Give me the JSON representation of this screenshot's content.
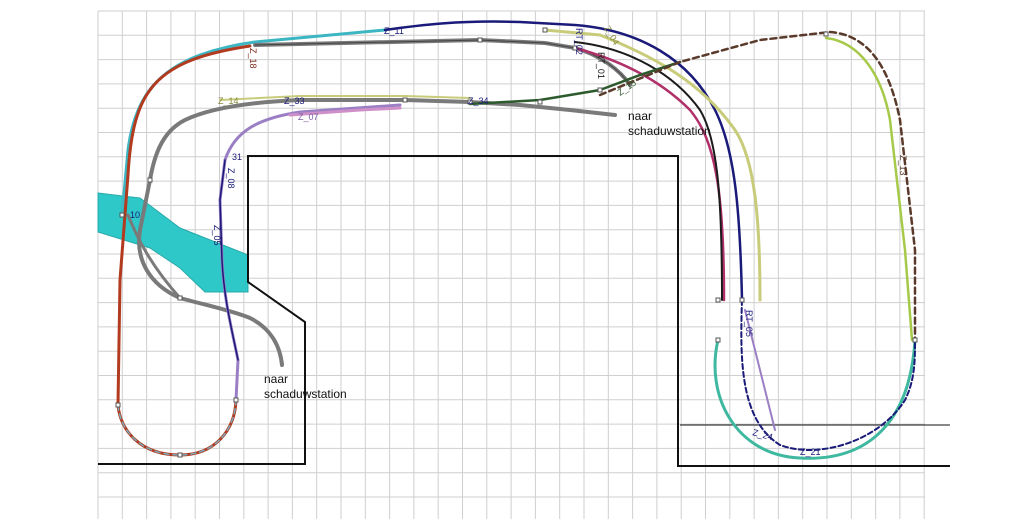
{
  "diagram": {
    "notes": [
      {
        "key": "shadow_right",
        "line1": "naar",
        "line2": "schaduwstation"
      },
      {
        "key": "shadow_left",
        "line1": "naar",
        "line2": "schaduwstation"
      }
    ],
    "labels": {
      "z11": "Z_11",
      "z18": "Z_18",
      "z14": "Z_14",
      "z33": "Z_33",
      "z07": "Z_07",
      "z31": "31",
      "z08": "Z_08",
      "z05": "Z_05",
      "z10": "10",
      "z34": "Z_34",
      "z15": "Z_15",
      "z21": "Z_21",
      "z24": "Z_24",
      "z13": "Z_13",
      "z04": "Z_04",
      "rt02": "RT_02",
      "rt01": "RT_01",
      "rt05": "RT_05"
    },
    "colors": {
      "teal": "#3bb6c2",
      "rust": "#b23a1e",
      "navy": "#1a1a7a",
      "gray": "#7a7a7a",
      "olive": "#c8cc7a",
      "lilac": "#9b7fc4",
      "pink": "#cf8fc8",
      "magenta": "#b0306a",
      "black": "#1b1b1b",
      "darkgreen": "#2c5a2c",
      "brown_dash": "#5a3a2a",
      "lime": "#a6c94a",
      "seagreen": "#3fb8a0",
      "water": "#2ec8c8"
    }
  }
}
